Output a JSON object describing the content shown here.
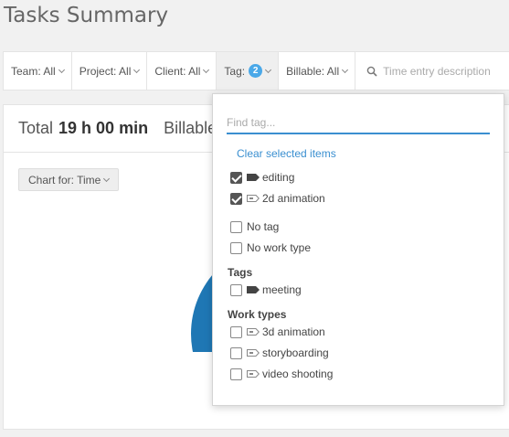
{
  "page": {
    "title": "Tasks Summary"
  },
  "filters": {
    "team": "Team: All",
    "project": "Project: All",
    "client": "Client: All",
    "tag": "Tag:",
    "tag_count": "2",
    "billable": "Billable: All",
    "search_placeholder": "Time entry description"
  },
  "summary": {
    "total_label": "Total",
    "total_value": "19 h 00 min",
    "billable_label": "Billable",
    "chart_button": "Chart for: Time"
  },
  "tag_dropdown": {
    "search_placeholder": "Find tag...",
    "clear_label": "Clear selected items",
    "selected": [
      {
        "label": "editing",
        "icon": "tag-icon",
        "checked": true
      },
      {
        "label": "2d animation",
        "icon": "work-type-icon",
        "checked": true
      }
    ],
    "special": [
      {
        "label": "No tag",
        "checked": false
      },
      {
        "label": "No work type",
        "checked": false
      }
    ],
    "tags_section": {
      "title": "Tags",
      "items": [
        {
          "label": "meeting",
          "icon": "tag-icon",
          "checked": false
        }
      ]
    },
    "work_types_section": {
      "title": "Work types",
      "items": [
        {
          "label": "3d animation",
          "icon": "work-type-icon",
          "checked": false
        },
        {
          "label": "storyboarding",
          "icon": "work-type-icon",
          "checked": false
        },
        {
          "label": "video shooting",
          "icon": "work-type-icon",
          "checked": false
        }
      ]
    }
  },
  "colors": {
    "accent": "#3a8fd0",
    "badge": "#4aa8e8",
    "pie": "#1f77b4"
  }
}
